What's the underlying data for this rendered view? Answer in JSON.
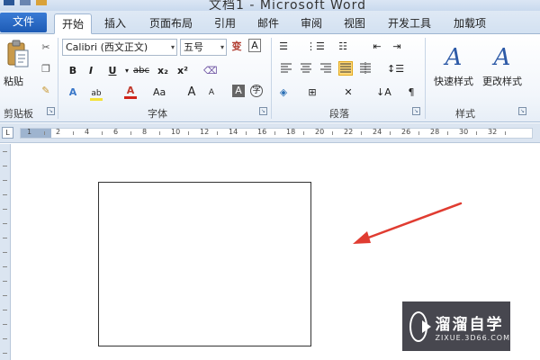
{
  "window": {
    "title": "文档1 - Microsoft Word"
  },
  "tabs": [
    {
      "label": "文件"
    },
    {
      "label": "开始"
    },
    {
      "label": "插入"
    },
    {
      "label": "页面布局"
    },
    {
      "label": "引用"
    },
    {
      "label": "邮件"
    },
    {
      "label": "审阅"
    },
    {
      "label": "视图"
    },
    {
      "label": "开发工具"
    },
    {
      "label": "加载项"
    }
  ],
  "ribbon": {
    "clipboard": {
      "paste_label": "粘贴",
      "group_label": "剪贴板"
    },
    "font": {
      "font_name": "Calibri (西文正文)",
      "font_size": "五号",
      "group_label": "字体",
      "bold": "B",
      "italic": "I",
      "underline": "U",
      "strike": "abc",
      "subscript": "x₂",
      "superscript": "x²",
      "grow": "A",
      "shrink": "A",
      "case": "Aa"
    },
    "paragraph": {
      "group_label": "段落"
    },
    "styles": {
      "quick_label": "快速样式",
      "change_label": "更改样式",
      "group_label": "样式"
    }
  },
  "ruler": {
    "numbers": [
      "1",
      "2",
      "4",
      "6",
      "8",
      "10",
      "12",
      "14",
      "16",
      "18",
      "20",
      "22",
      "24",
      "26",
      "28",
      "30",
      "32"
    ]
  },
  "watermark": {
    "brand": "溜溜自学",
    "url": "ZIXUE.3D66.COM"
  },
  "colors": {
    "file_tab": "#1d5bb5",
    "arrow": "#e03c31",
    "selected_button": "#ffd97a"
  }
}
